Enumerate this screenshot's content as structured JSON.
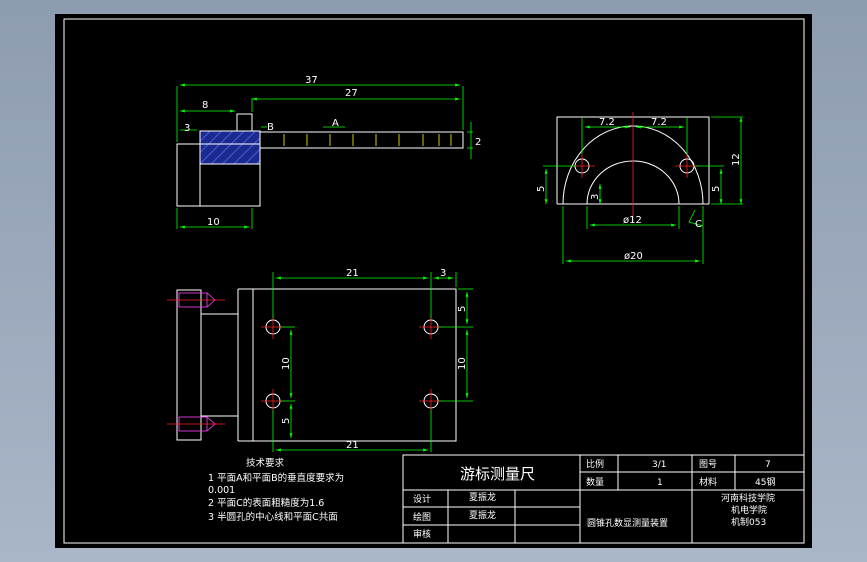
{
  "colors": {
    "background": "#000000",
    "outline": "#ffffff",
    "dimension": "#00ff00",
    "centerline": "#ff2020",
    "hatch": "#2a3aa8",
    "hidden": "#ffff00"
  },
  "views": {
    "front": {
      "dims": {
        "overall": "37",
        "right_span": "27",
        "left_span": "8",
        "step": "3",
        "bottom": "10",
        "thickness": "2"
      },
      "labels": {
        "b": "B",
        "a": "A"
      }
    },
    "side": {
      "dims": {
        "left_half": "7.2",
        "right_half": "7.2",
        "height": "12",
        "left_h": "5",
        "right_h": "5",
        "small": "3",
        "inner_dia": "ø12",
        "outer_dia": "ø20"
      },
      "labels": {
        "c": "C"
      }
    },
    "plan": {
      "dims": {
        "top": "21",
        "top_right": "3",
        "bottom": "21",
        "right_top": "5",
        "right_mid": "10",
        "left_mid": "10",
        "left_bottom": "5"
      }
    }
  },
  "notes": {
    "title": "技术要求",
    "lines": [
      "1  平面A和平面B的垂直度要求为",
      "0.001",
      "2  平面C的表面粗糙度为1.6",
      "3  半圆孔的中心线和平面C共面"
    ]
  },
  "title_block": {
    "drawing_name": "游标测量尺",
    "scale_label": "比例",
    "scale_value": "3/1",
    "sheet_label": "图号",
    "sheet_value": "7",
    "qty_label": "数量",
    "qty_value": "1",
    "material_label": "材料",
    "material_value": "45钢",
    "design_label": "设计",
    "design_name": "夏振龙",
    "drawn_label": "绘图",
    "drawn_name": "夏振龙",
    "review_label": "审核",
    "project": "圆锥孔数显测量装置",
    "school": "河南科技学院",
    "college": "机电学院",
    "class_name": "机制053"
  }
}
